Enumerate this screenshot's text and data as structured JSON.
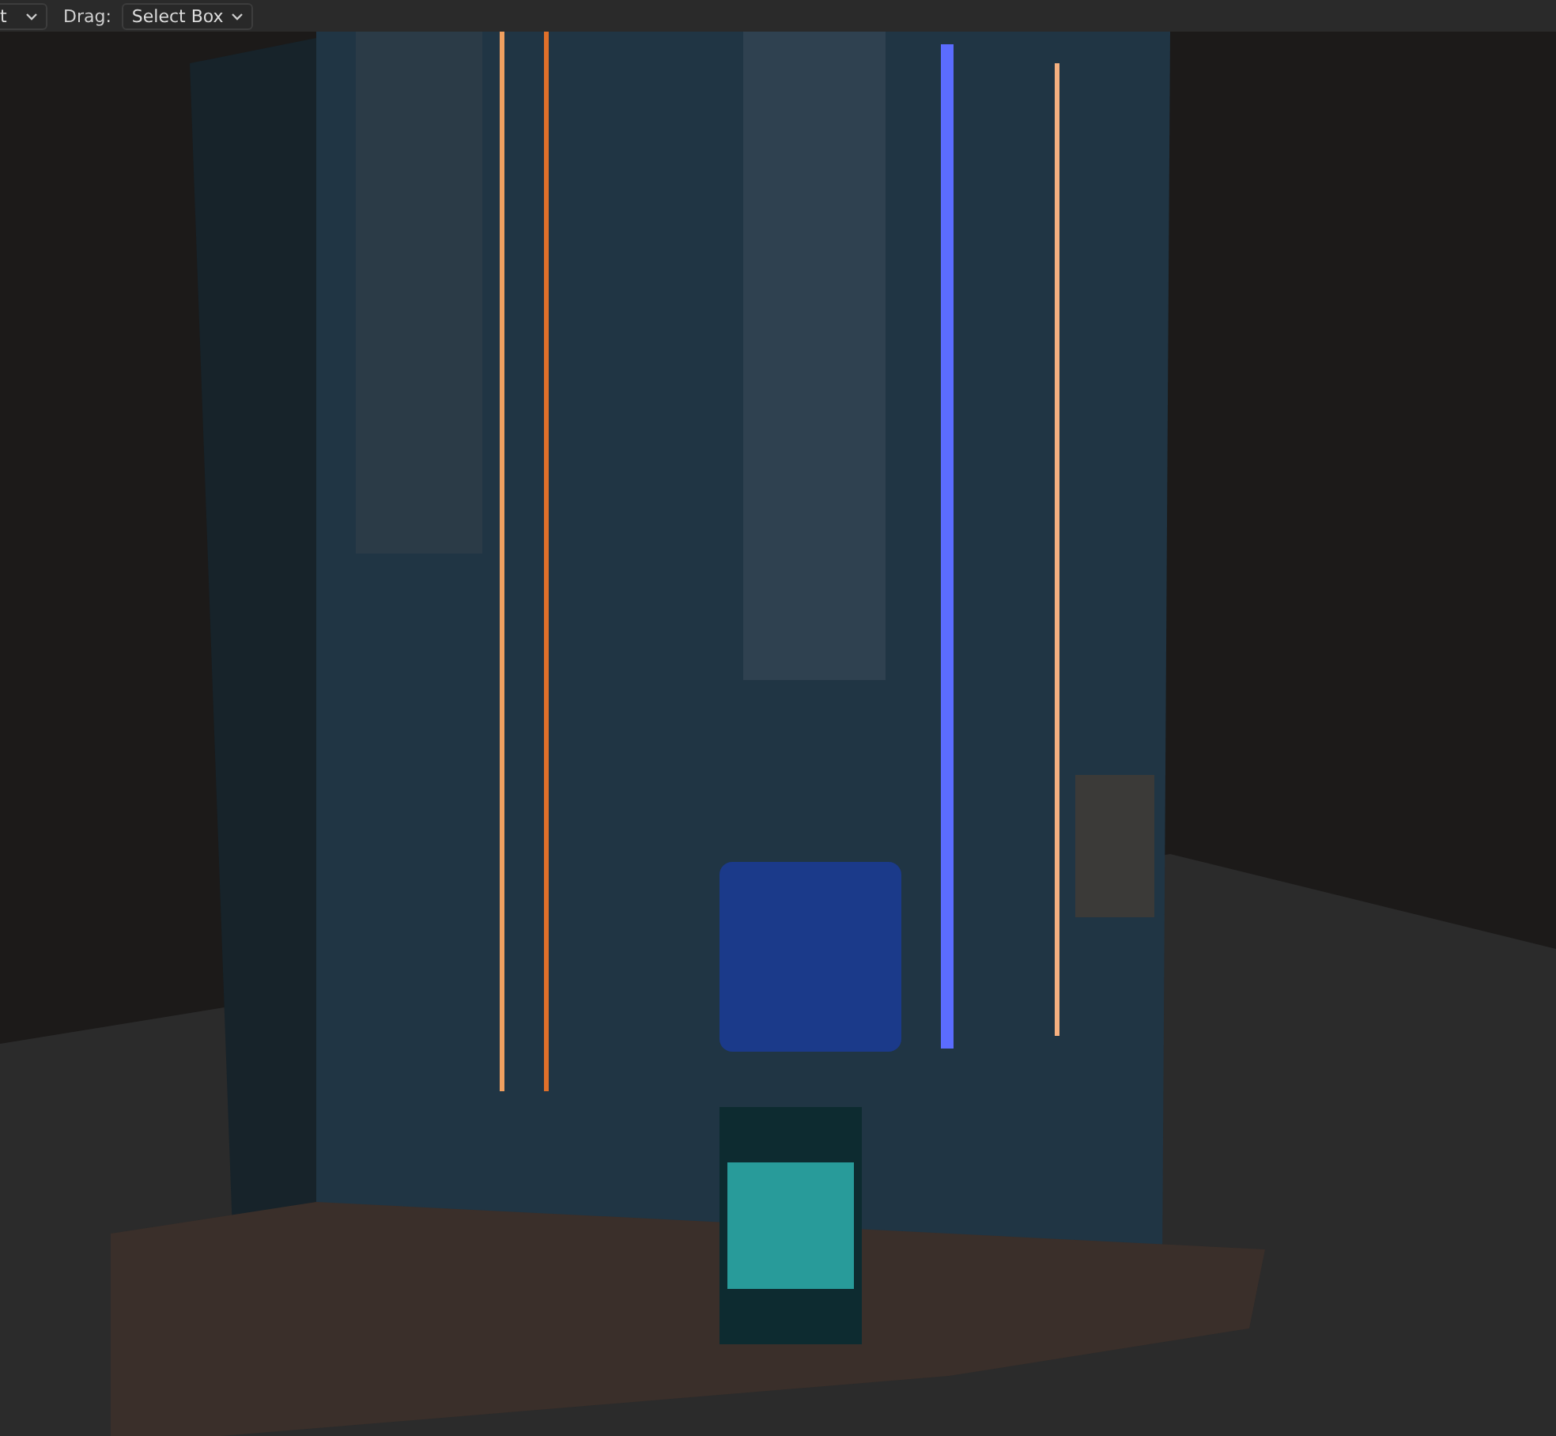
{
  "header": {
    "mode_dropdown": {
      "value": "t"
    },
    "drag_label": "Drag:",
    "drag_dropdown": {
      "value": "Select Box"
    }
  }
}
